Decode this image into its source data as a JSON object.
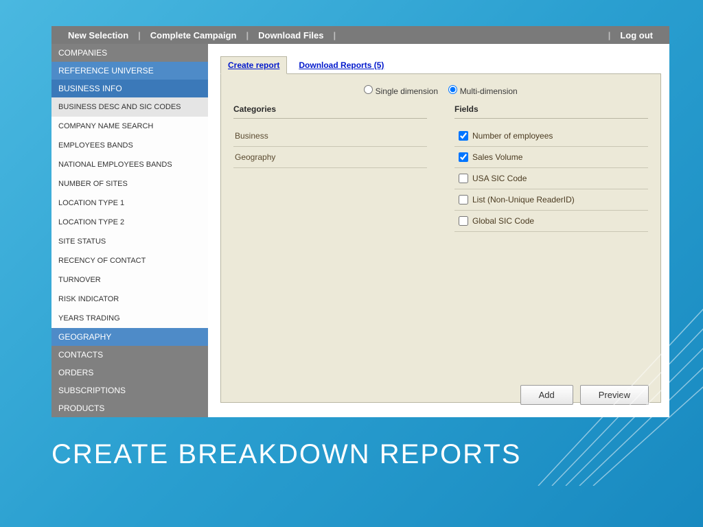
{
  "topnav": {
    "items": [
      "New Selection",
      "Complete Campaign",
      "Download Files"
    ],
    "logout": "Log out"
  },
  "sidebar": {
    "companies": "COMPANIES",
    "reference_universe": "REFERENCE UNIVERSE",
    "business_info": "BUSINESS INFO",
    "subitems": [
      "BUSINESS DESC AND SIC CODES",
      "COMPANY NAME SEARCH",
      "EMPLOYEES BANDS",
      "NATIONAL EMPLOYEES BANDS",
      "NUMBER OF SITES",
      "LOCATION TYPE 1",
      "LOCATION TYPE 2",
      "SITE STATUS",
      "RECENCY OF CONTACT",
      "TURNOVER",
      "RISK INDICATOR",
      "YEARS TRADING"
    ],
    "geography": "GEOGRAPHY",
    "contacts": "CONTACTS",
    "orders": "ORDERS",
    "subscriptions": "SUBSCRIPTIONS",
    "products": "PRODUCTS"
  },
  "tabs": {
    "create": "Create report",
    "download": "Download Reports (5)"
  },
  "report": {
    "single_dimension": "Single dimension",
    "multi_dimension": "Multi-dimension",
    "categories_header": "Categories",
    "fields_header": "Fields",
    "categories": [
      "Business",
      "Geography"
    ],
    "fields": [
      {
        "label": "Number of employees",
        "checked": true
      },
      {
        "label": "Sales Volume",
        "checked": true
      },
      {
        "label": "USA SIC Code",
        "checked": false
      },
      {
        "label": "List (Non-Unique ReaderID)",
        "checked": false
      },
      {
        "label": "Global SIC Code",
        "checked": false
      }
    ],
    "add_btn": "Add",
    "preview_btn": "Preview"
  },
  "slide_title": "CREATE BREAKDOWN REPORTS"
}
